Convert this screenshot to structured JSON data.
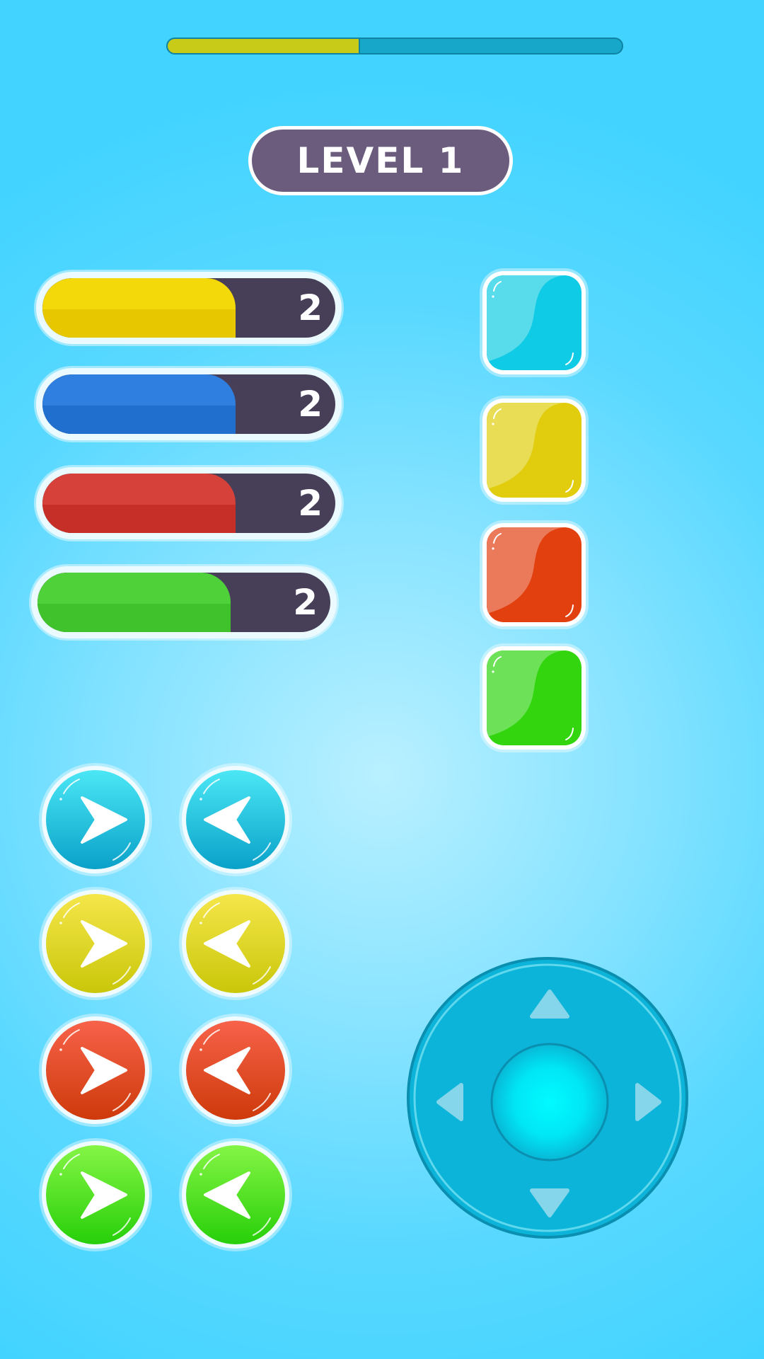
{
  "progress": {
    "value": 0.42,
    "fill_color": "#c8cc18",
    "track_color": "#17a7c8"
  },
  "level_label": "LEVEL 1",
  "color_bars": [
    {
      "name": "yellow",
      "count": "2",
      "fill": 0.66,
      "color": "#f3d90a",
      "shade": "#e7c800"
    },
    {
      "name": "blue",
      "count": "2",
      "fill": 0.66,
      "color": "#2f7fe0",
      "shade": "#206fcf"
    },
    {
      "name": "red",
      "count": "2",
      "fill": 0.66,
      "color": "#d6413a",
      "shade": "#c52f28"
    },
    {
      "name": "green",
      "count": "2",
      "fill": 0.66,
      "color": "#4fd13a",
      "shade": "#3fc22b"
    }
  ],
  "tiles": [
    {
      "name": "cyan",
      "light": "#58dcec",
      "dark": "#10cbe5"
    },
    {
      "name": "yellow",
      "light": "#e8dd55",
      "dark": "#e1cc0e"
    },
    {
      "name": "red",
      "light": "#eb7a5a",
      "dark": "#e2400f"
    },
    {
      "name": "green",
      "light": "#6de157",
      "dark": "#33d60e"
    }
  ],
  "arrow_buttons": [
    {
      "color": "cyan",
      "direction": "right",
      "top": "#4be7f5",
      "bottom": "#0aa1c9"
    },
    {
      "color": "cyan",
      "direction": "left",
      "top": "#4be7f5",
      "bottom": "#0aa1c9"
    },
    {
      "color": "yellow",
      "direction": "right",
      "top": "#f5e64a",
      "bottom": "#c9c70a"
    },
    {
      "color": "yellow",
      "direction": "left",
      "top": "#f5e64a",
      "bottom": "#c9c70a"
    },
    {
      "color": "red",
      "direction": "right",
      "top": "#f7624a",
      "bottom": "#ce3a0a"
    },
    {
      "color": "red",
      "direction": "left",
      "top": "#f7624a",
      "bottom": "#ce3a0a"
    },
    {
      "color": "green",
      "direction": "right",
      "top": "#85f545",
      "bottom": "#27cf09"
    },
    {
      "color": "green",
      "direction": "left",
      "top": "#85f545",
      "bottom": "#27cf09"
    }
  ],
  "joystick": {
    "base_color": "#0bb6da",
    "knob_color": "#00f0fa",
    "arrows": [
      "up",
      "down",
      "left",
      "right"
    ]
  }
}
